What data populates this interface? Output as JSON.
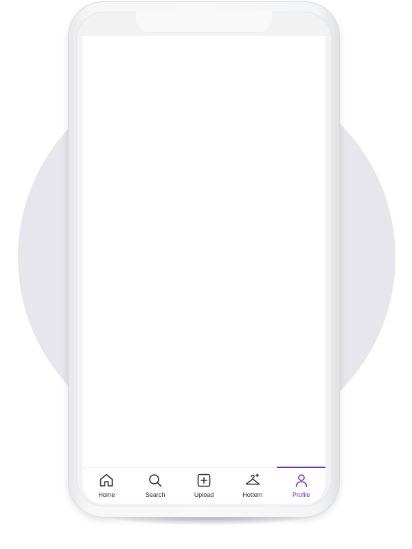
{
  "tab_bar": {
    "tabs": [
      {
        "label": "Home",
        "icon": "home-icon"
      },
      {
        "label": "Search",
        "icon": "search-icon"
      },
      {
        "label": "Upload",
        "icon": "upload-icon"
      },
      {
        "label": "Hottem",
        "icon": "hanger-icon"
      },
      {
        "label": "Profile",
        "icon": "profile-icon"
      }
    ],
    "active_tab": "Profile",
    "accent_color": "#6a2bd9",
    "icon_color": "#2f2f33"
  },
  "colors": {
    "backdrop_circle": "#e7e6ec",
    "screen_background": "#ffffff"
  }
}
